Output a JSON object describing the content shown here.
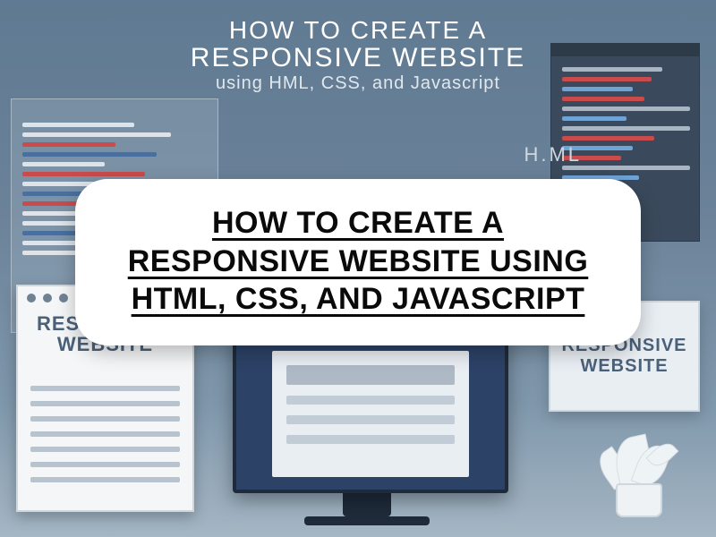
{
  "background_headline": {
    "line1": "HOW TO CREATE A",
    "line2": "RESPONSIVE WEBSITE",
    "line3": "using HML, CSS, and Javascript"
  },
  "side_label": "H.ML",
  "tablet_label": "RESPONSIVE WEBSITE",
  "card_label": "RESPONSIVE WEBSITE",
  "main_title": "HOW TO CREATE A RESPONSIVE WEBSITE USING HTML, CSS, AND JAVASCRIPT"
}
